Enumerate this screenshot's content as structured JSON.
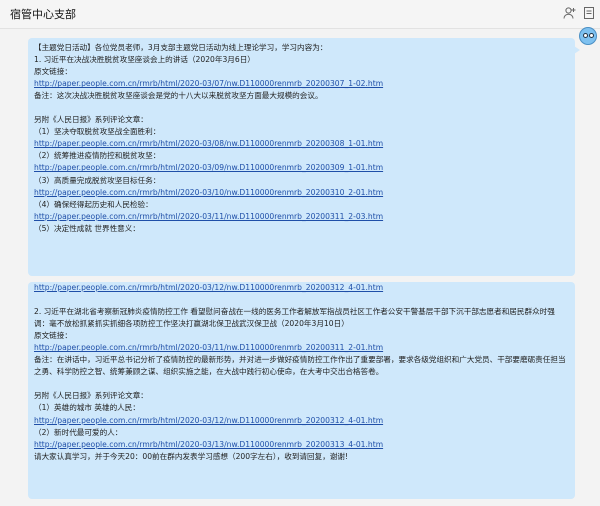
{
  "window": {
    "title": "宿管中心支部"
  },
  "message": {
    "part1": [
      {
        "type": "text",
        "text": "【主题党日活动】各位党员老师，3月支部主题党日活动为线上理论学习，学习内容为："
      },
      {
        "type": "text",
        "text": "1. 习近平在决战决胜脱贫攻坚座谈会上的讲话（2020年3月6日）"
      },
      {
        "type": "text",
        "text": "原文链接："
      },
      {
        "type": "link",
        "text": "http://paper.people.com.cn/rmrb/html/2020-03/07/nw.D110000renmrb_20200307_1-02.htm"
      },
      {
        "type": "text",
        "text": "备注：这次决战决胜脱贫攻坚座谈会是党的十八大以来脱贫攻坚方面最大规模的会议。"
      },
      {
        "type": "blank",
        "text": ""
      },
      {
        "type": "text",
        "text": "另附《人民日报》系列评论文章："
      },
      {
        "type": "text",
        "text": "（1）坚决夺取脱贫攻坚战全面胜利："
      },
      {
        "type": "link",
        "text": "http://paper.people.com.cn/rmrb/html/2020-03/08/nw.D110000renmrb_20200308_1-01.htm"
      },
      {
        "type": "text",
        "text": "（2）统筹推进疫情防控和脱贫攻坚："
      },
      {
        "type": "link",
        "text": "http://paper.people.com.cn/rmrb/html/2020-03/09/nw.D110000renmrb_20200309_1-01.htm"
      },
      {
        "type": "text",
        "text": "（3）高质量完成脱贫攻坚目标任务："
      },
      {
        "type": "link",
        "text": "http://paper.people.com.cn/rmrb/html/2020-03/10/nw.D110000renmrb_20200310_2-01.htm"
      },
      {
        "type": "text",
        "text": "（4）确保经得起历史和人民检验："
      },
      {
        "type": "link",
        "text": "http://paper.people.com.cn/rmrb/html/2020-03/11/nw.D110000renmrb_20200311_2-03.htm"
      },
      {
        "type": "text",
        "text": "（5）决定性成就 世界性意义："
      }
    ],
    "part2": [
      {
        "type": "link",
        "text": "http://paper.people.com.cn/rmrb/html/2020-03/12/nw.D110000renmrb_20200312_4-01.htm"
      },
      {
        "type": "blank",
        "text": ""
      },
      {
        "type": "wrap",
        "text": "2. 习近平在湖北省考察新冠肺炎疫情防控工作 看望慰问奋战在一线的医务工作者解放军指战员社区工作者公安干警基层干部下沉干部志愿者和居民群众时强调：毫不放松抓紧抓实抓细各项防控工作坚决打赢湖北保卫战武汉保卫战（2020年3月10日）"
      },
      {
        "type": "text",
        "text": "原文链接："
      },
      {
        "type": "link",
        "text": "http://paper.people.com.cn/rmrb/html/2020-03/11/nw.D110000renmrb_20200311_2-01.htm"
      },
      {
        "type": "wrap",
        "text": "备注：在讲话中，习近平总书记分析了疫情防控的最新形势，并对进一步做好疫情防控工作作出了重要部署，要求各级党组织和广大党员、干部要磨砺责任担当之勇、科学防控之智、统筹兼顾之谋、组织实施之能，在大战中践行初心使命，在大考中交出合格答卷。"
      },
      {
        "type": "blank",
        "text": ""
      },
      {
        "type": "text",
        "text": "另附《人民日报》系列评论文章："
      },
      {
        "type": "text",
        "text": "（1）英雄的城市 英雄的人民："
      },
      {
        "type": "link",
        "text": "http://paper.people.com.cn/rmrb/html/2020-03/12/nw.D110000renmrb_20200312_4-01.htm"
      },
      {
        "type": "text",
        "text": "（2）新时代最可爱的人："
      },
      {
        "type": "link",
        "text": "http://paper.people.com.cn/rmrb/html/2020-03/13/nw.D110000renmrb_20200313_4-01.htm"
      },
      {
        "type": "text",
        "text": "请大家认真学习，并于今天20：00前在群内发表学习感想（200字左右），收到请回复，谢谢!"
      }
    ]
  },
  "icons": {
    "add_member": "add-user-icon",
    "more": "more-icon"
  }
}
